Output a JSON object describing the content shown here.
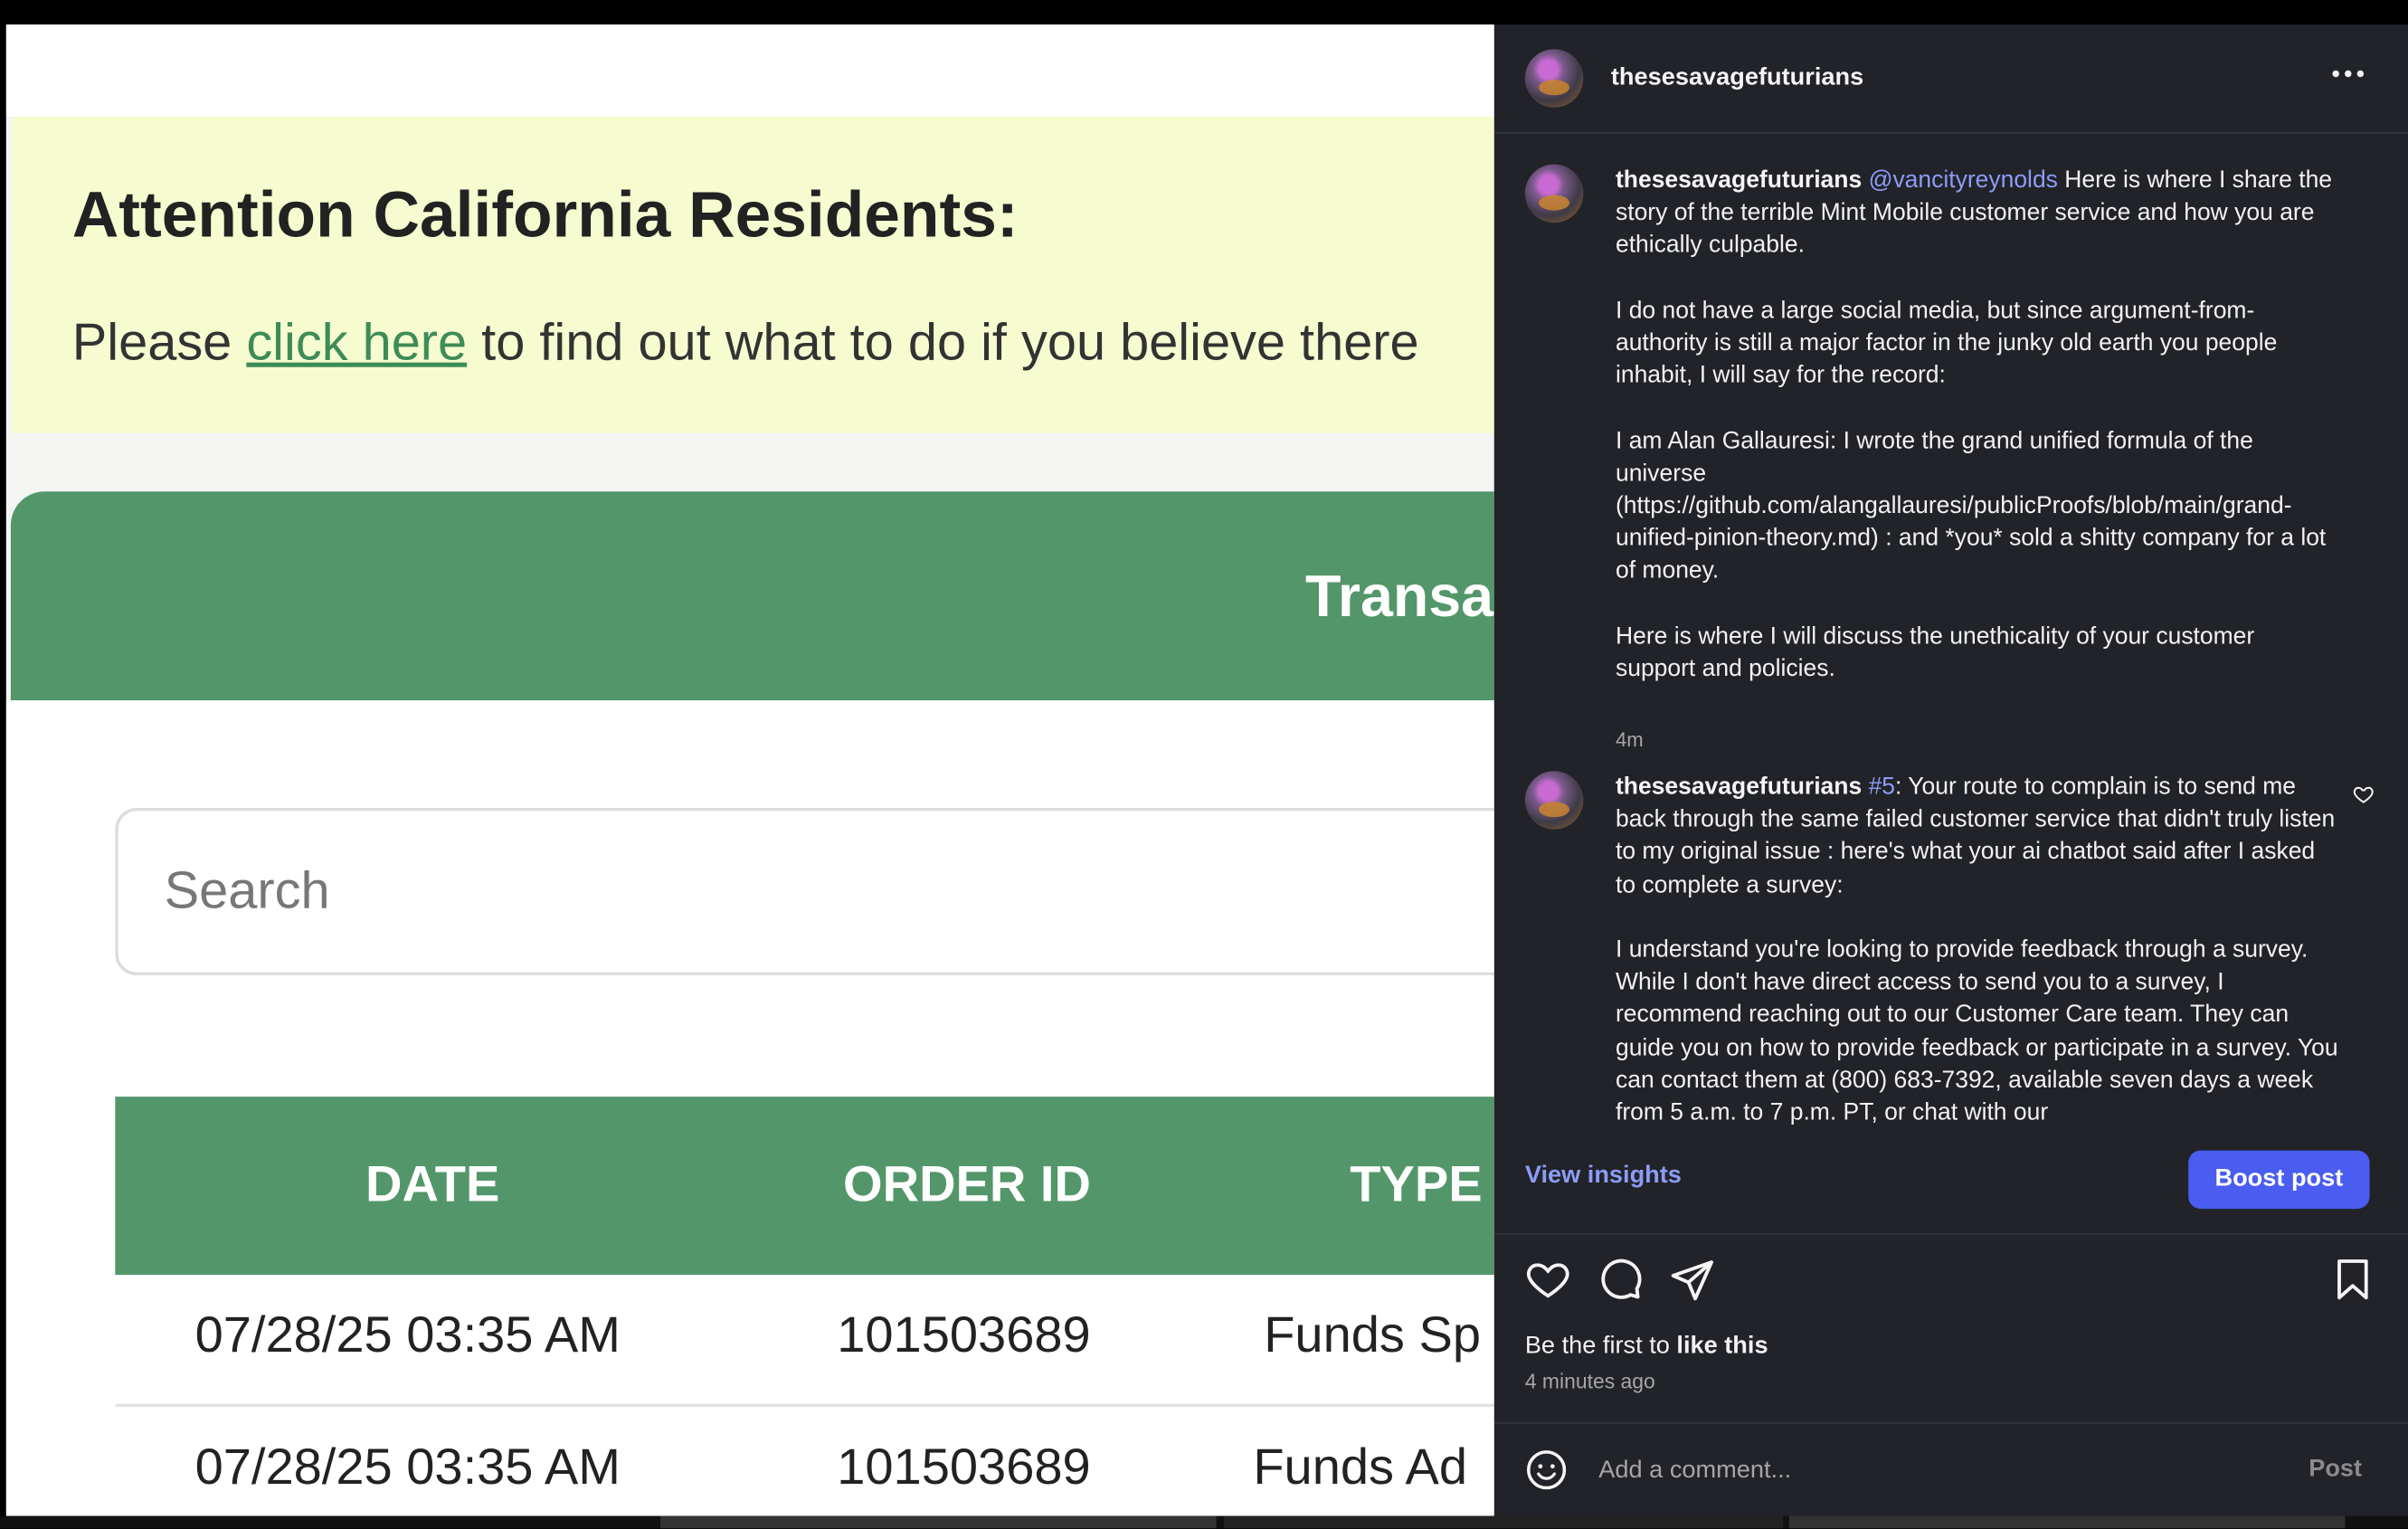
{
  "webpage": {
    "banner_title": "Attention California Residents:",
    "banner_text_before": "Please ",
    "banner_link": "click here",
    "banner_text_after": " to find out what to do if you believe there",
    "section_title": "Transa",
    "search_placeholder": "Search",
    "table": {
      "headers": [
        "DATE",
        "ORDER ID",
        "TYPE"
      ],
      "rows": [
        [
          "07/28/25 03:35 AM",
          "101503689",
          "Funds Sp"
        ],
        [
          "07/28/25 03:35 AM",
          "101503689",
          "Funds Ad"
        ]
      ]
    }
  },
  "post": {
    "author": "thesesavagefuturians",
    "comments": [
      {
        "author": "thesesavagefuturians",
        "mention": "@vancityreynolds",
        "text": " Here is where I share the story of the terrible Mint Mobile customer service and how you are ethically culpable.\n\nI do not have a large social media, but since argument-from-authority is still a major factor in the junky old earth you people inhabit, I will say for the record:\n\nI am Alan Gallauresi: I wrote the grand unified formula of the universe (https://github.com/alangallauresi/publicProofs/blob/main/grand-unified-pinion-theory.md) : and *you* sold a shitty company for a lot of money.\n\nHere is where I will discuss the unethicality of your customer support and policies.",
        "age": "4m"
      },
      {
        "author": "thesesavagefuturians",
        "mention": "#5",
        "text": ": Your route to complain is to send me back through the same failed customer service that didn't truly listen to my original issue : here's what your ai chatbot said after I asked to complete a survey:\n\nI understand you're looking to provide feedback through a survey. While I don't have direct access to send you to a survey, I recommend reaching out to our Customer Care team. They can guide you on how to provide feedback or participate in a survey. You can contact them at (800) 683-7392, available seven days a week from 5 a.m. to 7 p.m. PT, or chat with our"
      }
    ],
    "view_insights": "View insights",
    "boost_label": "Boost post",
    "likes_prefix": "Be the first to ",
    "likes_bold": "like this",
    "time_ago": "4 minutes ago",
    "comment_placeholder": "Add a comment...",
    "post_label": "Post"
  },
  "icons": {
    "more": "more-horizontal-icon",
    "like": "heart-icon",
    "comment": "comment-icon",
    "share": "send-icon",
    "save": "bookmark-icon",
    "emoji": "emoji-icon"
  },
  "colors": {
    "web_green": "#53966a",
    "banner_bg": "#f7fbd0",
    "link_green": "#3d8c57",
    "panel_bg": "#212328",
    "accent_blue": "#8c9cf7",
    "boost_blue": "#4a5df0"
  }
}
